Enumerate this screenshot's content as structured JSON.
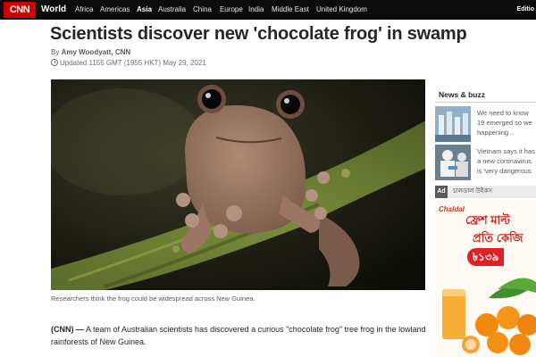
{
  "nav": {
    "logo": "CNN",
    "world": "World",
    "items": [
      "Africa",
      "Americas",
      "Asia",
      "Australia",
      "China",
      "Europe",
      "India",
      "Middle East",
      "United Kingdom"
    ],
    "active": "Asia",
    "edition": "Editio"
  },
  "article": {
    "headline": "Scientists discover new 'chocolate frog' in swamp",
    "byline_prefix": "By",
    "author": "Amy Woodyatt, CNN",
    "updated": "Updated 1155 GMT (1955 HKT) May 29, 2021",
    "caption": "Researchers think the frog could be widespread across New Guinea.",
    "lead_source": "(CNN) —",
    "lead_text": " A team of Australian scientists has discovered a curious \"chocolate frog\" tree frog in the lowland rainforests of New Guinea."
  },
  "sidebar": {
    "news_title": "News & buzz",
    "news": [
      {
        "lines": [
          "We need to know",
          "19 emerged so we",
          "happening..."
        ]
      },
      {
        "lines": [
          "Vietnam says it has",
          "a new coronavirus",
          "is 'very dangerous"
        ]
      }
    ],
    "ad_badge": "Ad",
    "ad_label": "চালডাল উইকস",
    "ad": {
      "brand": "Chaldal",
      "line1": "ফ্রেশ মাল্ট",
      "line2": "প্রতি কেজি",
      "price": "৳১৩৯"
    }
  },
  "colors": {
    "brand_red": "#cc0000",
    "nav_bg": "#0c0c0c",
    "ad_red": "#d0201e"
  }
}
